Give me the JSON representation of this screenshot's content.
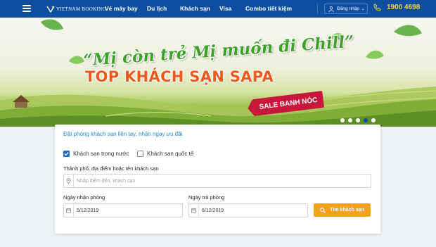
{
  "header": {
    "logo_text": "VIETNAM BOOKING",
    "nav": [
      {
        "label": "Vé máy bay"
      },
      {
        "label": "Du lịch"
      },
      {
        "label": "Khách sạn"
      },
      {
        "label": "Visa"
      },
      {
        "label": "Combo tiết kiệm"
      }
    ],
    "login_label": "Đăng nhập",
    "phone": "1900 4698",
    "icons": {
      "menu": "hamburger-icon",
      "user": "user-icon",
      "phone": "phone-icon"
    },
    "colors": {
      "background": "#0d4ea1",
      "phone": "#f6d33c"
    }
  },
  "banner": {
    "slogan": "“Mị còn trẻ Mị muốn đi Chill”",
    "headline": "TOP KHÁCH SẠN SAPA",
    "tag": "SALE BANH NÓC",
    "slides": 5,
    "active_slide": 4
  },
  "search": {
    "tagline": "Đặt phòng khách sạn liền tay, nhận ngay ưu đãi",
    "options": [
      {
        "label": "Khách sạn trong nước",
        "checked": true
      },
      {
        "label": "Khách sạn quốc tế",
        "checked": false
      }
    ],
    "destination_label": "Thành phố, địa điểm hoặc tên khách sạn",
    "destination_placeholder": "Nhập điểm đến, khách sạn",
    "checkin_label": "Ngày nhận phòng",
    "checkin_value": "5/12/2019",
    "checkout_label": "Ngày trả phòng",
    "checkout_value": "6/12/2019",
    "button_label": "Tìm khách sạn",
    "colors": {
      "accent": "#1a8ad8",
      "button": "#f4a11c"
    }
  }
}
